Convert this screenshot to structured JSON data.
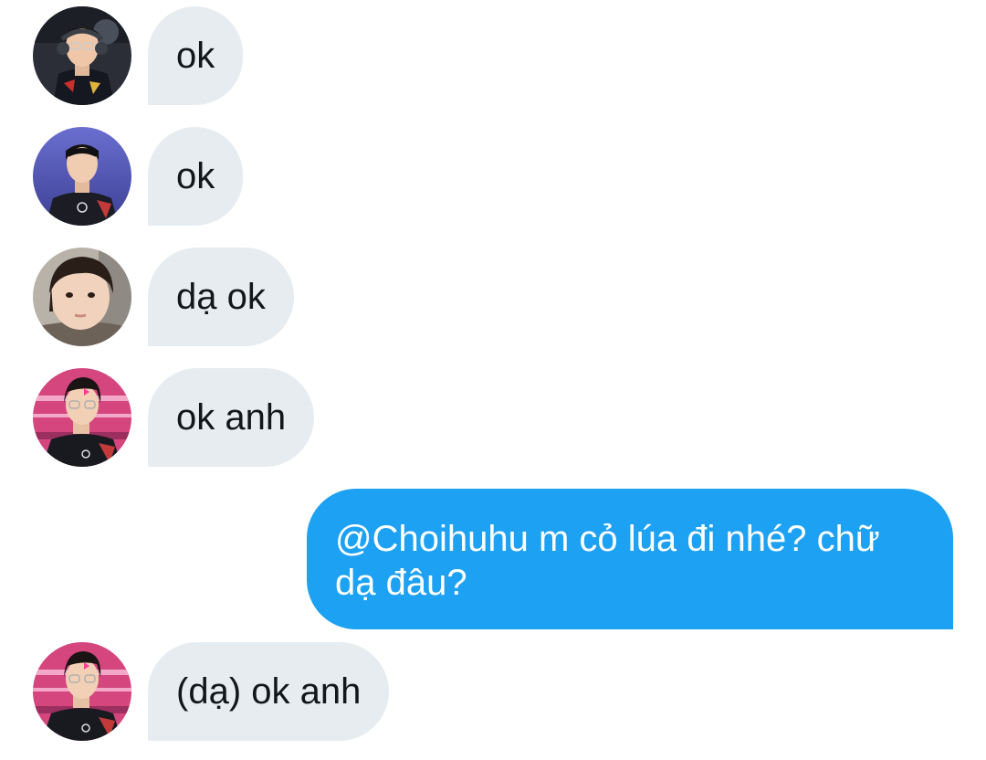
{
  "messages": [
    {
      "direction": "in",
      "avatar": "avatar-player-1",
      "text": "ok"
    },
    {
      "direction": "in",
      "avatar": "avatar-player-2",
      "text": "ok"
    },
    {
      "direction": "in",
      "avatar": "avatar-child",
      "text": "dạ ok"
    },
    {
      "direction": "in",
      "avatar": "avatar-player-3",
      "text": "ok anh"
    },
    {
      "direction": "out",
      "text": "@Choihuhu m cỏ lúa đi nhé? chữ dạ đâu?"
    },
    {
      "direction": "in",
      "avatar": "avatar-player-3",
      "text": "(dạ) ok anh"
    }
  ],
  "colors": {
    "incoming_bubble": "#e6ecf0",
    "outgoing_bubble": "#1da1f2",
    "incoming_text": "#14171a",
    "outgoing_text": "#ffffff"
  }
}
